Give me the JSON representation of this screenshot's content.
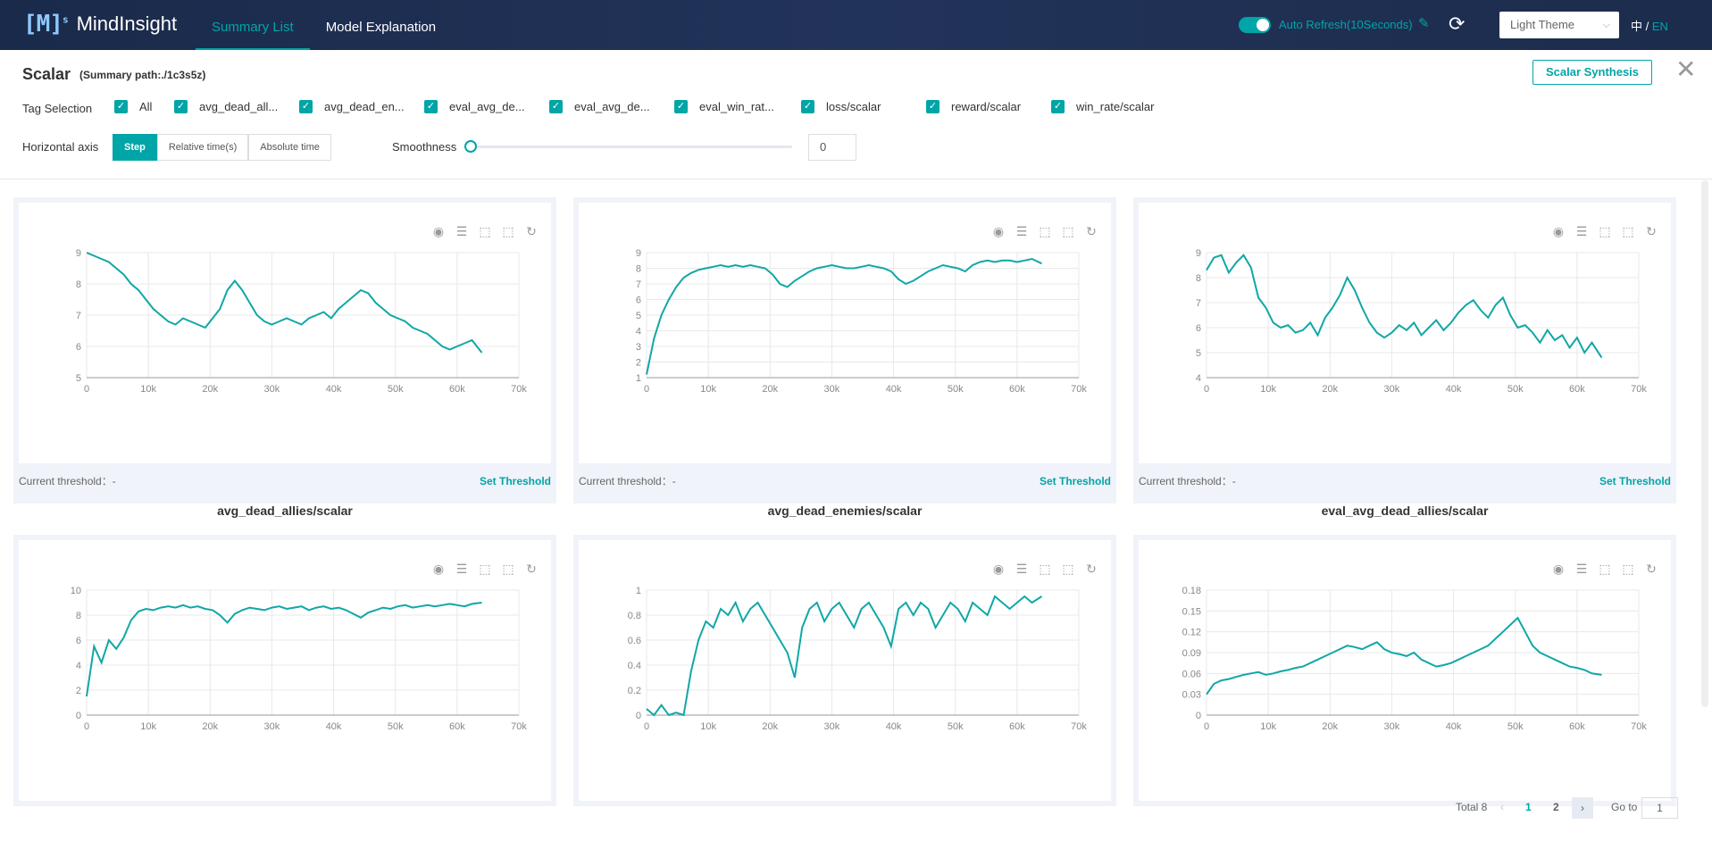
{
  "header": {
    "logo_mark": "[M]",
    "logo_sup": "s",
    "logo_text": "MindInsight",
    "nav": [
      {
        "label": "Summary List",
        "active": true
      },
      {
        "label": "Model Explanation",
        "active": false
      }
    ],
    "auto_refresh": "Auto Refresh(10Seconds)",
    "theme": "Light Theme",
    "lang_zh": "中",
    "lang_sep": "/",
    "lang_en": "EN"
  },
  "panel": {
    "title": "Scalar",
    "path": "(Summary path:./1c3s5z)",
    "synthesis_button": "Scalar Synthesis",
    "tag_selection_label": "Tag Selection",
    "tags": [
      "All",
      "avg_dead_all...",
      "avg_dead_en...",
      "eval_avg_de...",
      "eval_avg_de...",
      "eval_win_rat...",
      "loss/scalar",
      "reward/scalar",
      "win_rate/scalar"
    ],
    "horizontal_axis_label": "Horizontal axis",
    "axis_options": [
      {
        "label": "Step",
        "active": true
      },
      {
        "label": "Relative time(s)",
        "active": false
      },
      {
        "label": "Absolute time",
        "active": false
      }
    ],
    "smoothness_label": "Smoothness",
    "smoothness_value": "0"
  },
  "cards": [
    {
      "title": "avg_dead_allies/scalar",
      "threshold_label": "Current threshold：-",
      "set_threshold": "Set Threshold"
    },
    {
      "title": "avg_dead_enemies/scalar",
      "threshold_label": "Current threshold：-",
      "set_threshold": "Set Threshold"
    },
    {
      "title": "eval_avg_dead_allies/scalar",
      "threshold_label": "Current threshold：-",
      "set_threshold": "Set Threshold"
    },
    {
      "title": "",
      "threshold_label": "",
      "set_threshold": ""
    },
    {
      "title": "",
      "threshold_label": "",
      "set_threshold": ""
    },
    {
      "title": "",
      "threshold_label": "",
      "set_threshold": ""
    }
  ],
  "pagination": {
    "total": "Total 8",
    "pages": [
      "1",
      "2"
    ],
    "current": "1",
    "goto_label": "Go to",
    "goto_value": "1"
  },
  "colors": {
    "accent": "#00a5a7",
    "header_bg": "#1e2e50",
    "line": "#10a7a7"
  },
  "chart_data": [
    {
      "type": "line",
      "series": [
        {
          "values": [
            9,
            8.9,
            8.8,
            8.7,
            8.5,
            8.3,
            8.0,
            7.8,
            7.5,
            7.2,
            7.0,
            6.8,
            6.7,
            6.9,
            6.8,
            6.7,
            6.6,
            6.9,
            7.2,
            7.8,
            8.1,
            7.8,
            7.4,
            7.0,
            6.8,
            6.7,
            6.8,
            6.9,
            6.8,
            6.7,
            6.9,
            7.0,
            7.1,
            6.9,
            7.2,
            7.4,
            7.6,
            7.8,
            7.7,
            7.4,
            7.2,
            7.0,
            6.9,
            6.8,
            6.6,
            6.5,
            6.4,
            6.2,
            6.0,
            5.9,
            6.0,
            6.1,
            6.2,
            5.8
          ]
        }
      ],
      "x": [
        0,
        1200,
        2400,
        3600,
        4800,
        6000,
        7200,
        8400,
        9600,
        10800,
        12000,
        13200,
        14400,
        15600,
        16800,
        18000,
        19200,
        20400,
        21600,
        22800,
        24000,
        25200,
        26400,
        27600,
        28800,
        30000,
        31200,
        32400,
        33600,
        34800,
        36000,
        37200,
        38400,
        39600,
        40800,
        42000,
        43200,
        44400,
        45600,
        46800,
        48000,
        49200,
        50400,
        51600,
        52800,
        54000,
        55200,
        56400,
        57600,
        58800,
        60000,
        61200,
        62400,
        64000
      ],
      "xlim": [
        0,
        70000
      ],
      "ylim": [
        5,
        9
      ],
      "xticks": [
        "0",
        "10k",
        "20k",
        "30k",
        "40k",
        "50k",
        "60k",
        "70k"
      ],
      "yticks": [
        "5",
        "6",
        "7",
        "8",
        "9"
      ]
    },
    {
      "type": "line",
      "series": [
        {
          "values": [
            1.2,
            3.5,
            5.0,
            6.0,
            6.8,
            7.4,
            7.7,
            7.9,
            8.0,
            8.1,
            8.2,
            8.1,
            8.2,
            8.1,
            8.2,
            8.1,
            8.0,
            7.6,
            7.0,
            6.8,
            7.2,
            7.5,
            7.8,
            8.0,
            8.1,
            8.2,
            8.1,
            8.0,
            8.0,
            8.1,
            8.2,
            8.1,
            8.0,
            7.8,
            7.3,
            7.0,
            7.2,
            7.5,
            7.8,
            8.0,
            8.2,
            8.1,
            8.0,
            7.8,
            8.2,
            8.4,
            8.5,
            8.4,
            8.5,
            8.5,
            8.4,
            8.5,
            8.6,
            8.3
          ]
        }
      ],
      "x": [
        0,
        1200,
        2400,
        3600,
        4800,
        6000,
        7200,
        8400,
        9600,
        10800,
        12000,
        13200,
        14400,
        15600,
        16800,
        18000,
        19200,
        20400,
        21600,
        22800,
        24000,
        25200,
        26400,
        27600,
        28800,
        30000,
        31200,
        32400,
        33600,
        34800,
        36000,
        37200,
        38400,
        39600,
        40800,
        42000,
        43200,
        44400,
        45600,
        46800,
        48000,
        49200,
        50400,
        51600,
        52800,
        54000,
        55200,
        56400,
        57600,
        58800,
        60000,
        61200,
        62400,
        64000
      ],
      "xlim": [
        0,
        70000
      ],
      "ylim": [
        1,
        9
      ],
      "xticks": [
        "0",
        "10k",
        "20k",
        "30k",
        "40k",
        "50k",
        "60k",
        "70k"
      ],
      "yticks": [
        "1",
        "2",
        "3",
        "4",
        "5",
        "6",
        "7",
        "8",
        "9"
      ]
    },
    {
      "type": "line",
      "series": [
        {
          "values": [
            8.3,
            8.8,
            8.9,
            8.2,
            8.6,
            8.9,
            8.4,
            7.2,
            6.8,
            6.2,
            6.0,
            6.1,
            5.8,
            5.9,
            6.2,
            5.7,
            6.4,
            6.8,
            7.3,
            8.0,
            7.5,
            6.8,
            6.2,
            5.8,
            5.6,
            5.8,
            6.1,
            5.9,
            6.2,
            5.7,
            6.0,
            6.3,
            5.9,
            6.2,
            6.6,
            6.9,
            7.1,
            6.7,
            6.4,
            6.9,
            7.2,
            6.5,
            6.0,
            6.1,
            5.8,
            5.4,
            5.9,
            5.5,
            5.7,
            5.2,
            5.6,
            5.0,
            5.4,
            4.8
          ]
        }
      ],
      "x": [
        0,
        1200,
        2400,
        3600,
        4800,
        6000,
        7200,
        8400,
        9600,
        10800,
        12000,
        13200,
        14400,
        15600,
        16800,
        18000,
        19200,
        20400,
        21600,
        22800,
        24000,
        25200,
        26400,
        27600,
        28800,
        30000,
        31200,
        32400,
        33600,
        34800,
        36000,
        37200,
        38400,
        39600,
        40800,
        42000,
        43200,
        44400,
        45600,
        46800,
        48000,
        49200,
        50400,
        51600,
        52800,
        54000,
        55200,
        56400,
        57600,
        58800,
        60000,
        61200,
        62400,
        64000
      ],
      "xlim": [
        0,
        70000
      ],
      "ylim": [
        4,
        9
      ],
      "xticks": [
        "0",
        "10k",
        "20k",
        "30k",
        "40k",
        "50k",
        "60k",
        "70k"
      ],
      "yticks": [
        "4",
        "5",
        "6",
        "7",
        "8",
        "9"
      ]
    },
    {
      "type": "line",
      "series": [
        {
          "values": [
            1.5,
            5.5,
            4.2,
            6.0,
            5.3,
            6.2,
            7.6,
            8.3,
            8.5,
            8.4,
            8.6,
            8.7,
            8.6,
            8.8,
            8.6,
            8.7,
            8.5,
            8.4,
            8.0,
            7.4,
            8.1,
            8.4,
            8.6,
            8.5,
            8.4,
            8.6,
            8.7,
            8.5,
            8.6,
            8.7,
            8.4,
            8.6,
            8.7,
            8.5,
            8.6,
            8.4,
            8.1,
            7.8,
            8.2,
            8.4,
            8.6,
            8.5,
            8.7,
            8.8,
            8.6,
            8.7,
            8.8,
            8.7,
            8.8,
            8.9,
            8.8,
            8.7,
            8.9,
            9.0
          ]
        }
      ],
      "x": [
        0,
        1200,
        2400,
        3600,
        4800,
        6000,
        7200,
        8400,
        9600,
        10800,
        12000,
        13200,
        14400,
        15600,
        16800,
        18000,
        19200,
        20400,
        21600,
        22800,
        24000,
        25200,
        26400,
        27600,
        28800,
        30000,
        31200,
        32400,
        33600,
        34800,
        36000,
        37200,
        38400,
        39600,
        40800,
        42000,
        43200,
        44400,
        45600,
        46800,
        48000,
        49200,
        50400,
        51600,
        52800,
        54000,
        55200,
        56400,
        57600,
        58800,
        60000,
        61200,
        62400,
        64000
      ],
      "xlim": [
        0,
        70000
      ],
      "ylim": [
        0,
        10
      ],
      "xticks": [
        "0",
        "10k",
        "20k",
        "30k",
        "40k",
        "50k",
        "60k",
        "70k"
      ],
      "yticks": [
        "0",
        "2",
        "4",
        "6",
        "8",
        "10"
      ]
    },
    {
      "type": "line",
      "series": [
        {
          "values": [
            0.05,
            0.0,
            0.08,
            0.0,
            0.02,
            0.0,
            0.35,
            0.6,
            0.75,
            0.7,
            0.85,
            0.8,
            0.9,
            0.75,
            0.85,
            0.9,
            0.8,
            0.7,
            0.6,
            0.5,
            0.3,
            0.7,
            0.85,
            0.9,
            0.75,
            0.85,
            0.9,
            0.8,
            0.7,
            0.85,
            0.9,
            0.8,
            0.7,
            0.55,
            0.85,
            0.9,
            0.8,
            0.9,
            0.85,
            0.7,
            0.8,
            0.9,
            0.85,
            0.75,
            0.9,
            0.85,
            0.8,
            0.95,
            0.9,
            0.85,
            0.9,
            0.95,
            0.9,
            0.95
          ]
        }
      ],
      "x": [
        0,
        1200,
        2400,
        3600,
        4800,
        6000,
        7200,
        8400,
        9600,
        10800,
        12000,
        13200,
        14400,
        15600,
        16800,
        18000,
        19200,
        20400,
        21600,
        22800,
        24000,
        25200,
        26400,
        27600,
        28800,
        30000,
        31200,
        32400,
        33600,
        34800,
        36000,
        37200,
        38400,
        39600,
        40800,
        42000,
        43200,
        44400,
        45600,
        46800,
        48000,
        49200,
        50400,
        51600,
        52800,
        54000,
        55200,
        56400,
        57600,
        58800,
        60000,
        61200,
        62400,
        64000
      ],
      "xlim": [
        0,
        70000
      ],
      "ylim": [
        0,
        1
      ],
      "xticks": [
        "0",
        "10k",
        "20k",
        "30k",
        "40k",
        "50k",
        "60k",
        "70k"
      ],
      "yticks": [
        "0",
        "0.2",
        "0.4",
        "0.6",
        "0.8",
        "1"
      ]
    },
    {
      "type": "line",
      "series": [
        {
          "values": [
            0.03,
            0.045,
            0.05,
            0.052,
            0.055,
            0.058,
            0.06,
            0.062,
            0.058,
            0.06,
            0.063,
            0.065,
            0.068,
            0.07,
            0.075,
            0.08,
            0.085,
            0.09,
            0.095,
            0.1,
            0.098,
            0.095,
            0.1,
            0.105,
            0.095,
            0.09,
            0.088,
            0.085,
            0.09,
            0.08,
            0.075,
            0.07,
            0.072,
            0.075,
            0.08,
            0.085,
            0.09,
            0.095,
            0.1,
            0.11,
            0.12,
            0.13,
            0.14,
            0.12,
            0.1,
            0.09,
            0.085,
            0.08,
            0.075,
            0.07,
            0.068,
            0.065,
            0.06,
            0.058
          ]
        }
      ],
      "x": [
        0,
        1200,
        2400,
        3600,
        4800,
        6000,
        7200,
        8400,
        9600,
        10800,
        12000,
        13200,
        14400,
        15600,
        16800,
        18000,
        19200,
        20400,
        21600,
        22800,
        24000,
        25200,
        26400,
        27600,
        28800,
        30000,
        31200,
        32400,
        33600,
        34800,
        36000,
        37200,
        38400,
        39600,
        40800,
        42000,
        43200,
        44400,
        45600,
        46800,
        48000,
        49200,
        50400,
        51600,
        52800,
        54000,
        55200,
        56400,
        57600,
        58800,
        60000,
        61200,
        62400,
        64000
      ],
      "xlim": [
        0,
        70000
      ],
      "ylim": [
        0,
        0.18
      ],
      "xticks": [
        "0",
        "10k",
        "20k",
        "30k",
        "40k",
        "50k",
        "60k",
        "70k"
      ],
      "yticks": [
        "0",
        "0.03",
        "0.06",
        "0.09",
        "0.12",
        "0.15",
        "0.18"
      ]
    }
  ]
}
